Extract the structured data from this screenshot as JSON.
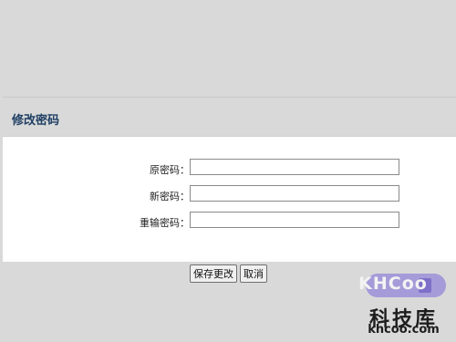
{
  "panel": {
    "title": "修改密码"
  },
  "form": {
    "fields": [
      {
        "label": "原密码：",
        "value": ""
      },
      {
        "label": "新密码：",
        "value": ""
      },
      {
        "label": "重输密码：",
        "value": ""
      }
    ]
  },
  "buttons": {
    "save_label": "保存更改",
    "cancel_label": "取消"
  },
  "watermark": {
    "logo_text": "KHCoo",
    "name": "科技库",
    "url": "khcoo.com"
  }
}
